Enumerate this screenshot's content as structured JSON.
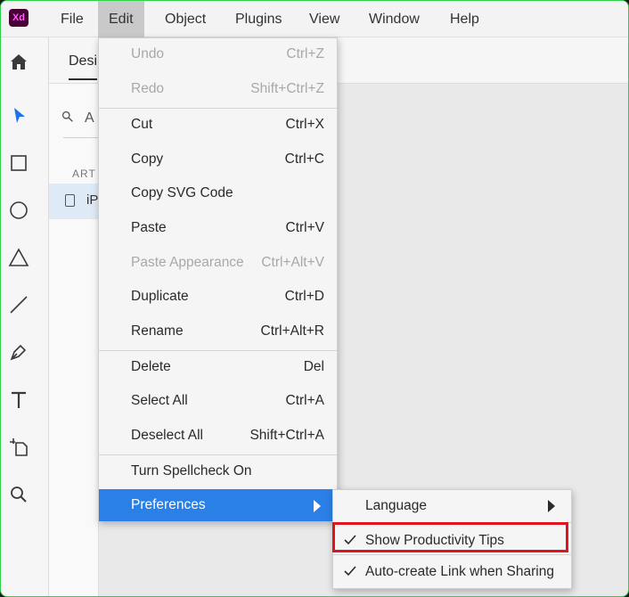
{
  "app": {
    "logo_text": "Xd",
    "logo_bg": "#470137",
    "logo_fg": "#ff61f6"
  },
  "menubar": {
    "items": [
      "File",
      "Edit",
      "Object",
      "Plugins",
      "View",
      "Window",
      "Help"
    ],
    "active": "Edit"
  },
  "subbar": {
    "design_tab": "Desi"
  },
  "panel": {
    "search_text": "A",
    "header": "ART",
    "row_text": "iP"
  },
  "toolbar": {
    "tools": [
      "home-icon",
      "select-arrow-icon",
      "rectangle-icon",
      "ellipse-icon",
      "triangle-icon",
      "line-icon",
      "pen-icon",
      "text-icon",
      "artboard-icon",
      "zoom-icon"
    ]
  },
  "edit_menu": {
    "items": [
      {
        "label": "Undo",
        "shortcut": "Ctrl+Z",
        "disabled": true
      },
      {
        "label": "Redo",
        "shortcut": "Shift+Ctrl+Z",
        "disabled": true
      },
      {
        "label": "Cut",
        "shortcut": "Ctrl+X"
      },
      {
        "label": "Copy",
        "shortcut": "Ctrl+C"
      },
      {
        "label": "Copy SVG Code",
        "shortcut": ""
      },
      {
        "label": "Paste",
        "shortcut": "Ctrl+V"
      },
      {
        "label": "Paste Appearance",
        "shortcut": "Ctrl+Alt+V",
        "disabled": true
      },
      {
        "label": "Duplicate",
        "shortcut": "Ctrl+D"
      },
      {
        "label": "Rename",
        "shortcut": "Ctrl+Alt+R"
      },
      {
        "label": "Delete",
        "shortcut": "Del"
      },
      {
        "label": "Select All",
        "shortcut": "Ctrl+A"
      },
      {
        "label": "Deselect All",
        "shortcut": "Shift+Ctrl+A"
      },
      {
        "label": "Turn Spellcheck On",
        "shortcut": ""
      },
      {
        "label": "Preferences",
        "shortcut": "",
        "highlighted": true
      }
    ]
  },
  "preferences_submenu": {
    "items": [
      {
        "label": "Language",
        "checked": false,
        "has_submenu": true
      },
      {
        "label": "Show Productivity Tips",
        "checked": true,
        "focused": true
      },
      {
        "label": "Auto-create Link when Sharing",
        "checked": true
      }
    ]
  },
  "colors": {
    "highlight": "#2a80e6",
    "focus_outline": "#e0141e",
    "window_border": "#2bd24a"
  }
}
